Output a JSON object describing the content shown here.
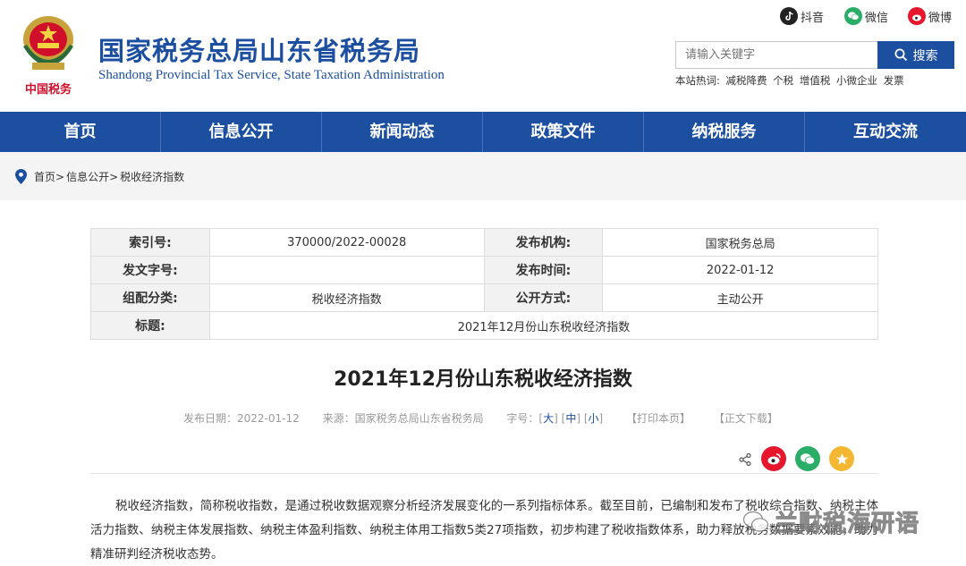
{
  "header": {
    "title": "国家税务总局山东省税务局",
    "subtitle": "Shandong Provincial Tax Service, State Taxation Administration",
    "emblem_text": "中国税务"
  },
  "social": {
    "douyin": "抖音",
    "weixin": "微信",
    "weibo": "微博"
  },
  "search": {
    "placeholder": "请输入关键字",
    "button": "搜索",
    "hot_label": "本站热词:",
    "hot_words": [
      "减税降费",
      "个税",
      "增值税",
      "小微企业",
      "发票"
    ]
  },
  "nav": [
    "首页",
    "信息公开",
    "新闻动态",
    "政策文件",
    "纳税服务",
    "互动交流"
  ],
  "breadcrumb": [
    "首页>",
    "信息公开>",
    "税收经济指数"
  ],
  "info": {
    "index_label": "索引号:",
    "index_value": "370000/2022-00028",
    "org_label": "发布机构:",
    "org_value": "国家税务总局",
    "doc_label": "发文字号:",
    "doc_value": "",
    "date_label": "发布时间:",
    "date_value": "2022-01-12",
    "cat_label": "组配分类:",
    "cat_value": "税收经济指数",
    "mode_label": "公开方式:",
    "mode_value": "主动公开",
    "title_label": "标题:",
    "title_value": "2021年12月份山东税收经济指数"
  },
  "article": {
    "title": "2021年12月份山东税收经济指数",
    "date": "发布日期：2022-01-12",
    "source": "来源：国家税务总局山东省税务局",
    "fontsize_label": "字号：[",
    "fs_large": "大",
    "fs_sep1": "] [",
    "fs_medium": "中",
    "fs_sep2": "] [",
    "fs_small": "小",
    "fs_end": "]",
    "print": "【打印本页】",
    "download": "【正文下载】",
    "body": "税收经济指数，简称税收指数，是通过税收数据观察分析经济发展变化的一系列指标体系。截至目前，已编制和发布了税收综合指数、纳税主体活力指数、纳税主体发展指数、纳税主体盈利指数、纳税主体用工指数5类27项指数，初步构建了税收指数体系，助力释放税务数据要素效能，助力精准研判经济税收态势。"
  },
  "watermark": "兰财税海研语",
  "colors": {
    "brand_blue": "#1d4fa0",
    "weibo_red": "#e6162d",
    "wechat_green": "#2aae67",
    "star_yellow": "#f3b731"
  }
}
